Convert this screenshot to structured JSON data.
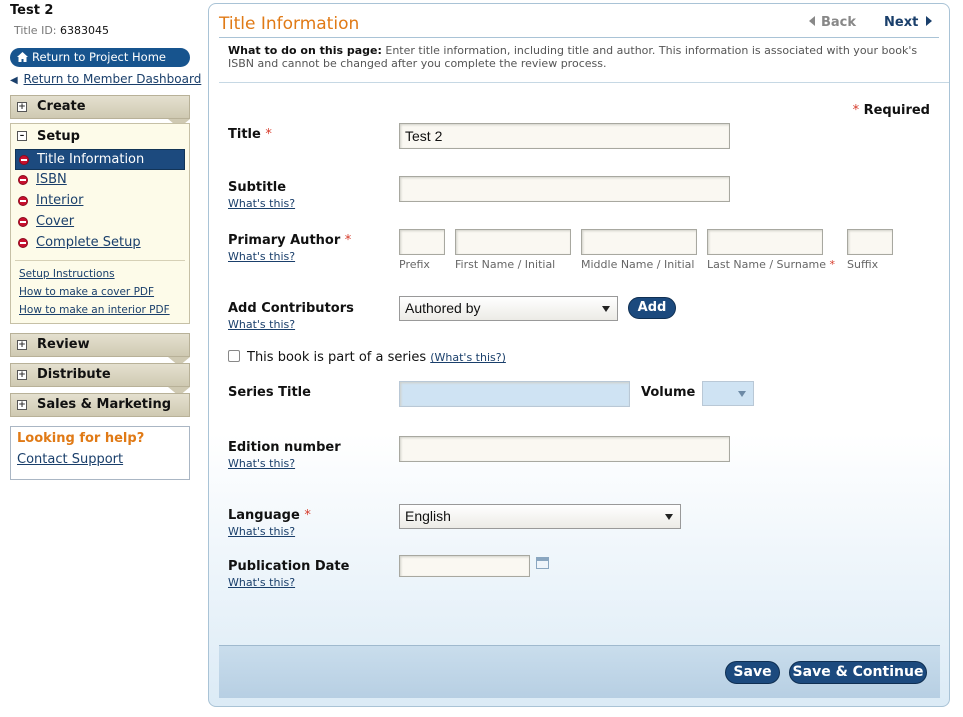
{
  "project": {
    "title": "Test 2",
    "title_id_label": "Title ID:",
    "title_id_value": "6383045",
    "return_home": "Return to Project Home",
    "return_dashboard": "Return to Member Dashboard"
  },
  "sidebar": {
    "sections": {
      "create": "Create",
      "setup": "Setup",
      "review": "Review",
      "distribute": "Distribute",
      "sales": "Sales & Marketing"
    },
    "setup_steps": [
      {
        "label": "Title Information"
      },
      {
        "label": "ISBN"
      },
      {
        "label": "Interior"
      },
      {
        "label": "Cover"
      },
      {
        "label": "Complete Setup"
      }
    ],
    "help_links": [
      {
        "label": "Setup Instructions"
      },
      {
        "label": "How to make a cover PDF"
      },
      {
        "label": "How to make an interior PDF"
      }
    ],
    "help_box": {
      "title": "Looking for help?",
      "link": "Contact Support"
    }
  },
  "main": {
    "title": "Title Information",
    "nav": {
      "back": "Back",
      "next": "Next"
    },
    "instructions_label": "What to do on this page:",
    "instructions_text": "Enter title information, including title and author. This information is associated with your book's ISBN and cannot be changed after you complete the review process.",
    "required_note": "Required",
    "whats_this": "What's this?",
    "fields": {
      "title_label": "Title",
      "title_value": "Test 2",
      "subtitle_label": "Subtitle",
      "subtitle_value": "",
      "primary_author_label": "Primary Author",
      "author_captions": {
        "prefix": "Prefix",
        "first": "First Name / Initial",
        "middle": "Middle Name / Initial",
        "last": "Last Name / Surname",
        "suffix": "Suffix"
      },
      "contributors_label": "Add Contributors",
      "contributors_selected": "Authored by",
      "add_button": "Add",
      "series_checkbox_label": "This book is part of a series",
      "series_whats_this": "(What's this?)",
      "series_title_label": "Series Title",
      "volume_label": "Volume",
      "edition_label": "Edition number",
      "language_label": "Language",
      "language_selected": "English",
      "pubdate_label": "Publication Date"
    },
    "buttons": {
      "save": "Save",
      "save_continue": "Save & Continue"
    }
  },
  "colors": {
    "accent_orange": "#e07a16",
    "primary_blue": "#1c4a7e",
    "required_star": "#d63a2a",
    "step_incomplete": "#c8102e"
  }
}
